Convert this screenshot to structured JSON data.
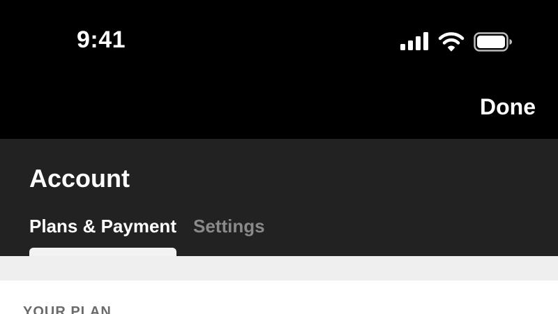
{
  "status_bar": {
    "time": "9:41",
    "icons": [
      "cellular-signal-icon",
      "wifi-icon",
      "battery-icon"
    ]
  },
  "nav": {
    "done_label": "Done"
  },
  "header": {
    "title": "Account",
    "tabs": [
      {
        "label": "Plans & Payment",
        "active": true
      },
      {
        "label": "Settings",
        "active": false
      }
    ]
  },
  "content": {
    "section_label": "YOUR PLAN"
  },
  "colors": {
    "status_bg": "#000000",
    "header_bg": "#222222",
    "active_tab": "#ffffff",
    "inactive_tab": "#8a8a8a",
    "band_bg": "#efefef",
    "content_bg": "#ffffff"
  }
}
